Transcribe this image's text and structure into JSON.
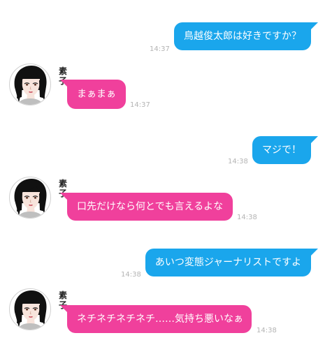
{
  "messages": [
    {
      "side": "right",
      "text": "鳥越俊太郎は好きですか？",
      "time": "14:37"
    },
    {
      "side": "left",
      "sender": "素子",
      "text": "まぁまぁ",
      "time": "14:37"
    },
    {
      "side": "right",
      "text": "マジで！",
      "time": "14:38"
    },
    {
      "side": "left",
      "sender": "素子",
      "text": "口先だけなら何とでも言えるよな",
      "time": "14:38"
    },
    {
      "side": "right",
      "text": "あいつ変態ジャーナリストですよ",
      "time": "14:38"
    },
    {
      "side": "left",
      "sender": "素子",
      "text": "ネチネチネチネチ……気持ち悪いなぁ",
      "time": "14:38"
    }
  ],
  "colors": {
    "right_bubble": "#1aa6ec",
    "left_bubble": "#f0409c",
    "timestamp": "#b4b4b4"
  },
  "avatar_icon": "woman-with-black-bob-hair-icon"
}
